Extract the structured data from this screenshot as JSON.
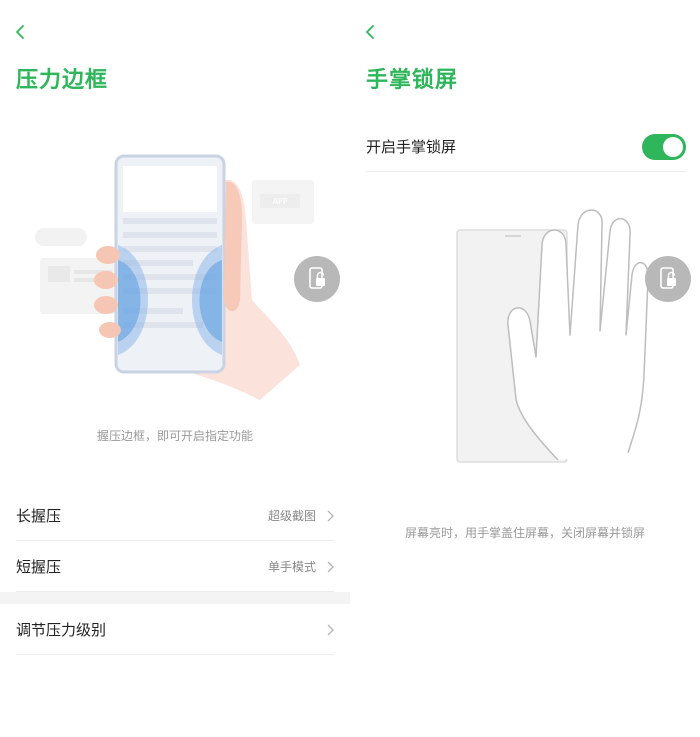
{
  "left": {
    "title": "压力边框",
    "caption": "握压边框，即可开启指定功能",
    "settings": [
      {
        "label": "长握压",
        "value": "超级截图"
      },
      {
        "label": "短握压",
        "value": "单手模式"
      },
      {
        "label": "调节压力级别",
        "value": ""
      }
    ],
    "illustration_badge": "APP"
  },
  "right": {
    "title": "手掌锁屏",
    "toggle_label": "开启手掌锁屏",
    "toggle_on": true,
    "caption": "屏幕亮时，用手掌盖住屏幕，关闭屏幕并锁屏"
  },
  "colors": {
    "accent": "#2fb65b",
    "hint_text": "#9a9a9a",
    "divider": "#ececec"
  },
  "icons": [
    "back-icon",
    "chevron-right-icon",
    "lock-phone-icon"
  ]
}
